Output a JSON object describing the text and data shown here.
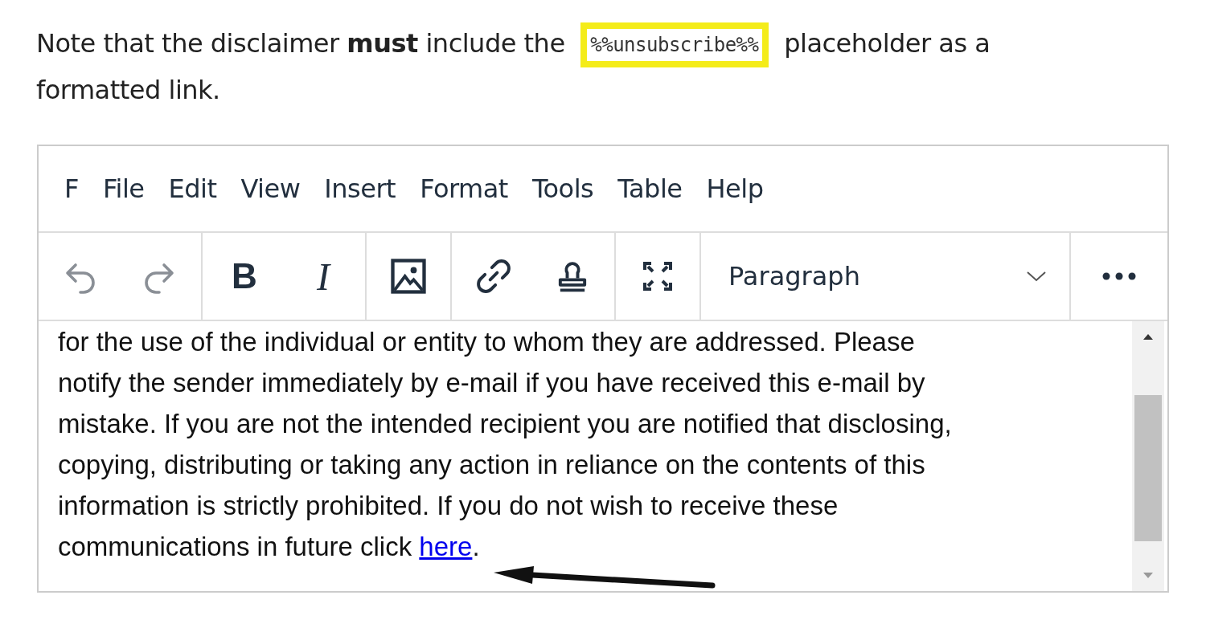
{
  "note": [
    {
      "kind": "text",
      "text": "Note that the disclaimer **must** include the "
    },
    {
      "kind": "code",
      "text": "%%unsubscribe%%"
    },
    {
      "kind": "text",
      "text": " placeholder as a formatted link."
    }
  ],
  "editor": {
    "menu": [
      "F",
      "File",
      "Edit",
      "View",
      "Insert",
      "Format",
      "Tools",
      "Table",
      "Help"
    ],
    "toolbar": [
      [
        {
          "kind": "undo",
          "disabled": true
        },
        {
          "kind": "redo",
          "disabled": true
        }
      ],
      [
        {
          "kind": "bold",
          "label": "B"
        },
        {
          "kind": "italic",
          "label": "I"
        }
      ],
      [
        {
          "kind": "image"
        }
      ],
      [
        {
          "kind": "link"
        },
        {
          "kind": "stamp"
        }
      ],
      [
        {
          "kind": "fullscreen"
        }
      ]
    ],
    "block_format": "Paragraph",
    "content": {
      "lines": [
        "for the use of the individual or entity to whom they are addressed. Please",
        "notify the sender immediately by e-mail if you have received this e-mail by",
        "mistake. If you are not the intended recipient you are notified that disclosing,",
        "copying, distributing or taking any action in reliance on the contents of this",
        "information is strictly prohibited. If you do not wish to receive these",
        "communications in future click "
      ],
      "link": "here",
      "after": "."
    }
  }
}
